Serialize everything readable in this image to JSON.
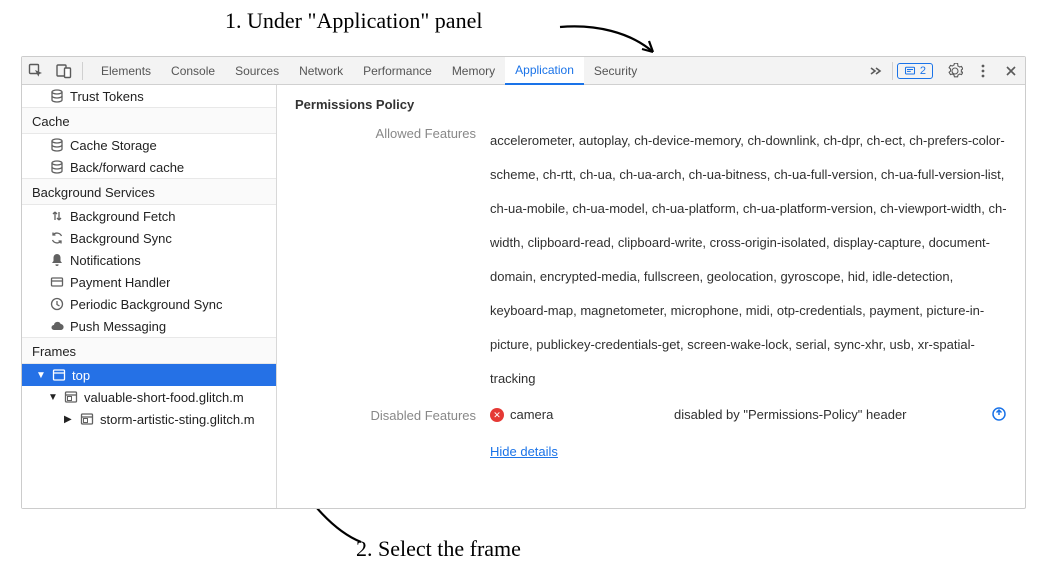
{
  "annotations": {
    "step1": "1. Under \"Application\" panel",
    "step2": "2. Select the frame"
  },
  "tabs": {
    "items": [
      "Elements",
      "Console",
      "Sources",
      "Network",
      "Performance",
      "Memory",
      "Application",
      "Security"
    ],
    "active": "Application",
    "issue_count": "2"
  },
  "sidebar": {
    "orphan_items": [
      {
        "id": "trust-tokens",
        "icon": "db",
        "label": "Trust Tokens"
      }
    ],
    "groups": [
      {
        "title": "Cache",
        "items": [
          {
            "id": "cache-storage",
            "icon": "db",
            "label": "Cache Storage"
          },
          {
            "id": "bf-cache",
            "icon": "db",
            "label": "Back/forward cache"
          }
        ]
      },
      {
        "title": "Background Services",
        "items": [
          {
            "id": "bg-fetch",
            "icon": "updown",
            "label": "Background Fetch"
          },
          {
            "id": "bg-sync",
            "icon": "sync",
            "label": "Background Sync"
          },
          {
            "id": "notifications",
            "icon": "bell",
            "label": "Notifications"
          },
          {
            "id": "payment",
            "icon": "card",
            "label": "Payment Handler"
          },
          {
            "id": "periodic-sync",
            "icon": "clock",
            "label": "Periodic Background Sync"
          },
          {
            "id": "push",
            "icon": "cloud",
            "label": "Push Messaging"
          }
        ]
      },
      {
        "title": "Frames",
        "items": [
          {
            "id": "frame-top",
            "icon": "window",
            "label": "top",
            "depth": 0,
            "selected": true,
            "disclosure": "▼"
          },
          {
            "id": "frame-valuable",
            "icon": "iframe",
            "label": "valuable-short-food.glitch.m",
            "depth": 1,
            "disclosure": "▼"
          },
          {
            "id": "frame-storm",
            "icon": "iframe",
            "label": "storm-artistic-sting.glitch.m",
            "depth": 2,
            "disclosure": "▶"
          }
        ]
      }
    ]
  },
  "panel": {
    "title": "Permissions Policy",
    "rows": {
      "allowed": {
        "label": "Allowed Features",
        "value": "accelerometer, autoplay, ch-device-memory, ch-downlink, ch-dpr, ch-ect, ch-prefers-color-scheme, ch-rtt, ch-ua, ch-ua-arch, ch-ua-bitness, ch-ua-full-version, ch-ua-full-version-list, ch-ua-mobile, ch-ua-model, ch-ua-platform, ch-ua-platform-version, ch-viewport-width, ch-width, clipboard-read, clipboard-write, cross-origin-isolated, display-capture, document-domain, encrypted-media, fullscreen, geolocation, gyroscope, hid, idle-detection, keyboard-map, magnetometer, microphone, midi, otp-credentials, payment, picture-in-picture, publickey-credentials-get, screen-wake-lock, serial, sync-xhr, usb, xr-spatial-tracking"
      },
      "disabled": {
        "label": "Disabled Features",
        "feature": "camera",
        "reason": "disabled by \"Permissions-Policy\" header",
        "details_link": "Hide details"
      }
    }
  }
}
